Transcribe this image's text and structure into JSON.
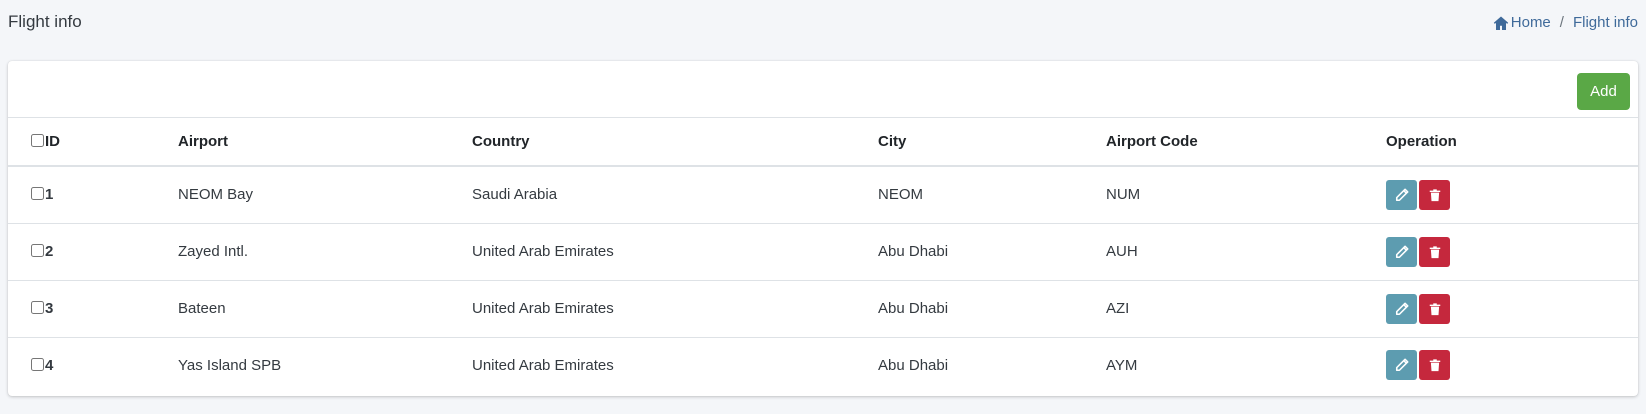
{
  "header": {
    "title": "Flight info",
    "breadcrumb": {
      "home": "Home",
      "separator": "/",
      "current": "Flight info"
    }
  },
  "toolbar": {
    "add_label": "Add"
  },
  "table": {
    "columns": [
      "ID",
      "Airport",
      "Country",
      "City",
      "Airport Code",
      "Operation"
    ],
    "rows": [
      {
        "id": "1",
        "airport": "NEOM Bay",
        "country": "Saudi Arabia",
        "city": "NEOM",
        "code": "NUM"
      },
      {
        "id": "2",
        "airport": "Zayed Intl.",
        "country": "United Arab Emirates",
        "city": "Abu Dhabi",
        "code": "AUH"
      },
      {
        "id": "3",
        "airport": "Bateen",
        "country": "United Arab Emirates",
        "city": "Abu Dhabi",
        "code": "AZI"
      },
      {
        "id": "4",
        "airport": "Yas Island SPB",
        "country": "United Arab Emirates",
        "city": "Abu Dhabi",
        "code": "AYM"
      }
    ]
  },
  "icons": {
    "home": "home-icon",
    "edit": "pencil-icon",
    "delete": "trash-icon"
  },
  "colors": {
    "add": "#5aa846",
    "edit": "#5d9cb0",
    "delete": "#c5283d",
    "link": "#3f6a9a"
  }
}
